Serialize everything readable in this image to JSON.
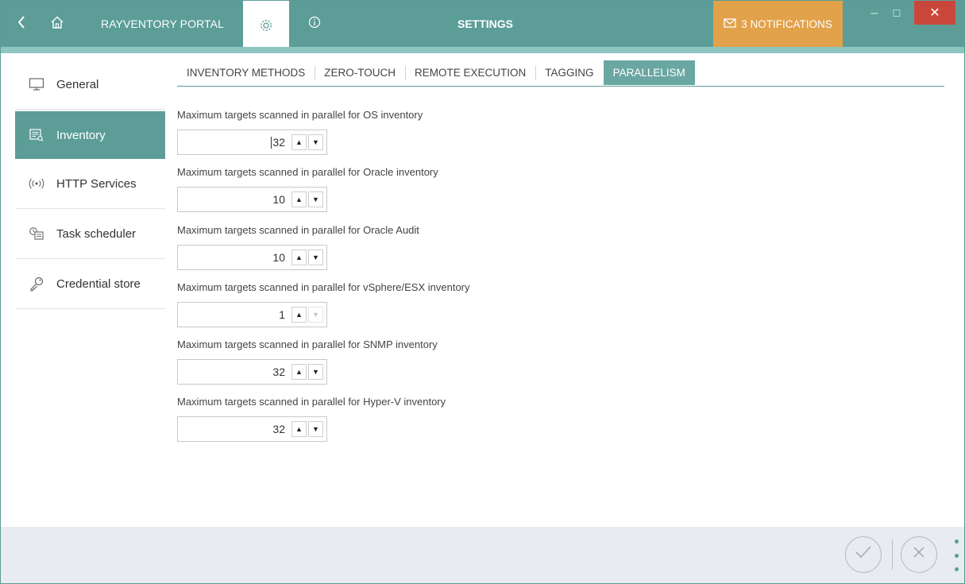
{
  "titlebar": {
    "back_icon": "chevron-left-icon",
    "home_icon": "home-icon",
    "portal_title": "RAYVENTORY PORTAL",
    "settings_icon": "gear-icon",
    "info_icon": "info-icon",
    "page_title": "SETTINGS",
    "notifications_label": "3 NOTIFICATIONS",
    "notifications_icon": "mail-icon",
    "accent_color": "#5c9d98",
    "notify_color": "#e2a24a",
    "close_color": "#c9473a"
  },
  "sidebar": {
    "items": [
      {
        "label": "General",
        "icon": "monitor-icon",
        "active": false
      },
      {
        "label": "Inventory",
        "icon": "inventory-icon",
        "active": true
      },
      {
        "label": "HTTP Services",
        "icon": "broadcast-icon",
        "active": false
      },
      {
        "label": "Task scheduler",
        "icon": "scheduler-icon",
        "active": false
      },
      {
        "label": "Credential store",
        "icon": "key-icon",
        "active": false
      }
    ]
  },
  "tabs": [
    {
      "label": "INVENTORY METHODS",
      "active": false
    },
    {
      "label": "ZERO-TOUCH",
      "active": false
    },
    {
      "label": "REMOTE EXECUTION",
      "active": false
    },
    {
      "label": "TAGGING",
      "active": false
    },
    {
      "label": "PARALLELISM",
      "active": true
    }
  ],
  "settings": [
    {
      "label": "Maximum targets scanned in parallel for OS inventory",
      "value": "32",
      "focused": true,
      "down_disabled": false
    },
    {
      "label": "Maximum targets scanned in parallel for Oracle inventory",
      "value": "10",
      "focused": false,
      "down_disabled": false
    },
    {
      "label": "Maximum targets scanned in parallel for Oracle Audit",
      "value": "10",
      "focused": false,
      "down_disabled": false
    },
    {
      "label": "Maximum targets scanned in parallel for vSphere/ESX inventory",
      "value": "1",
      "focused": false,
      "down_disabled": true
    },
    {
      "label": "Maximum targets scanned in parallel for SNMP inventory",
      "value": "32",
      "focused": false,
      "down_disabled": false
    },
    {
      "label": "Maximum targets scanned in parallel for Hyper-V inventory",
      "value": "32",
      "focused": false,
      "down_disabled": false
    }
  ],
  "footer": {
    "ok_icon": "check-circle-icon",
    "cancel_icon": "x-circle-icon",
    "more_icon": "more-vertical-icon"
  }
}
